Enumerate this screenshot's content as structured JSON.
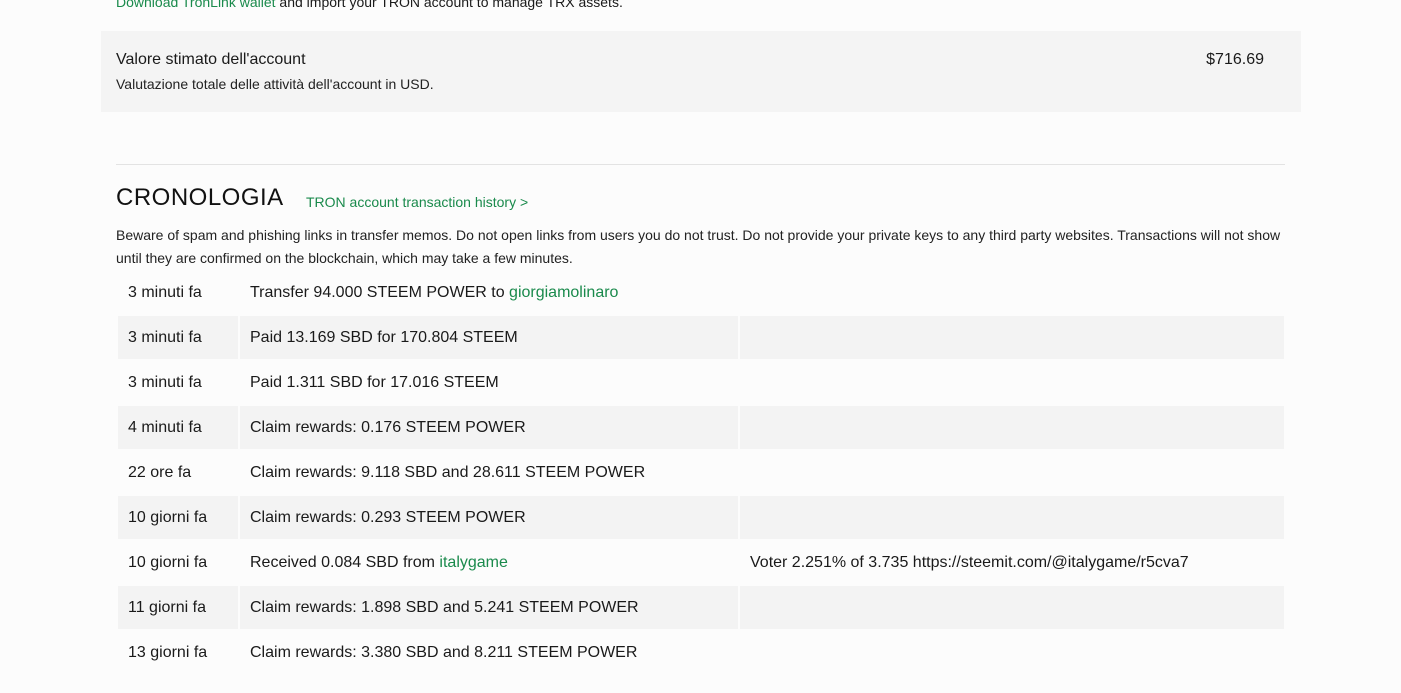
{
  "tron_note": {
    "link_text": "Download TronLink wallet",
    "rest_text": " and import your TRON account to manage TRX assets."
  },
  "estimated_value": {
    "title": "Valore stimato dell'account",
    "subtitle": "Valutazione totale delle attività dell'account in USD.",
    "amount": "$716.69"
  },
  "history": {
    "heading": "CRONOLOGIA",
    "tron_link": "TRON account transaction history >",
    "warning": "Beware of spam and phishing links in transfer memos. Do not open links from users you do not trust. Do not provide your private keys to any third party websites. Transactions will not show until they are confirmed on the blockchain, which may take a few minutes.",
    "rows": [
      {
        "time": "3 minuti fa",
        "op_prefix": "Transfer 94.000 STEEM POWER to ",
        "op_user": "giorgiamolinaro",
        "op_suffix": "",
        "memo": ""
      },
      {
        "time": "3 minuti fa",
        "op_prefix": "Paid 13.169 SBD for 170.804 STEEM",
        "op_user": "",
        "op_suffix": "",
        "memo": ""
      },
      {
        "time": "3 minuti fa",
        "op_prefix": "Paid 1.311 SBD for 17.016 STEEM",
        "op_user": "",
        "op_suffix": "",
        "memo": ""
      },
      {
        "time": "4 minuti fa",
        "op_prefix": "Claim rewards: 0.176 STEEM POWER",
        "op_user": "",
        "op_suffix": "",
        "memo": ""
      },
      {
        "time": "22 ore fa",
        "op_prefix": "Claim rewards: 9.118 SBD and 28.611 STEEM POWER",
        "op_user": "",
        "op_suffix": "",
        "memo": ""
      },
      {
        "time": "10 giorni fa",
        "op_prefix": "Claim rewards: 0.293 STEEM POWER",
        "op_user": "",
        "op_suffix": "",
        "memo": ""
      },
      {
        "time": "10 giorni fa",
        "op_prefix": "Received 0.084 SBD from ",
        "op_user": "italygame",
        "op_suffix": "",
        "memo": "Voter 2.251% of 3.735 https://steemit.com/@italygame/r5cva7"
      },
      {
        "time": "11 giorni fa",
        "op_prefix": "Claim rewards: 1.898 SBD and 5.241 STEEM POWER",
        "op_user": "",
        "op_suffix": "",
        "memo": ""
      },
      {
        "time": "13 giorni fa",
        "op_prefix": "Claim rewards: 3.380 SBD and 8.211 STEEM POWER",
        "op_user": "",
        "op_suffix": "",
        "memo": ""
      }
    ]
  }
}
